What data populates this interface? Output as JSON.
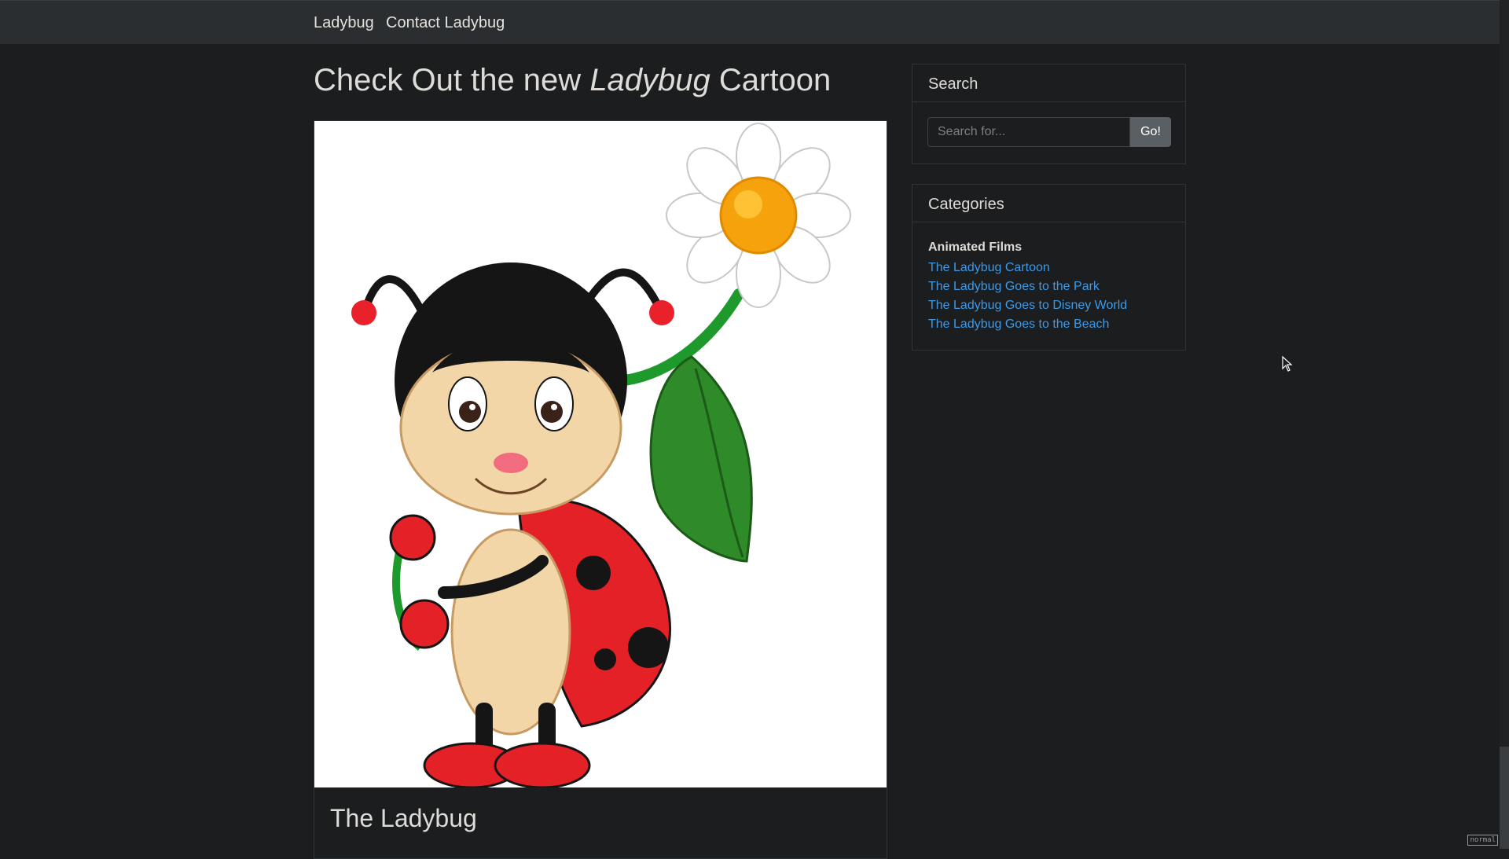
{
  "nav": {
    "brand": "Ladybug",
    "contact": "Contact Ladybug"
  },
  "post": {
    "title_prefix": "Check Out the new",
    "title_emphasis": "Ladybug",
    "title_suffix": "Cartoon",
    "card_title": "The Ladybug"
  },
  "search": {
    "heading": "Search",
    "placeholder": "Search for...",
    "button": "Go!"
  },
  "categories": {
    "heading": "Categories",
    "group": "Animated Films",
    "items": [
      "The Ladybug Cartoon",
      "The Ladybug Goes to the Park",
      "The Ladybug Goes to Disney World",
      "The Ladybug Goes to the Beach"
    ]
  },
  "status": {
    "mode": "normal"
  },
  "colors": {
    "background": "#1b1d1f",
    "navbar": "#2b2e30",
    "link": "#3d9ae8",
    "button": "#5a5f64"
  }
}
